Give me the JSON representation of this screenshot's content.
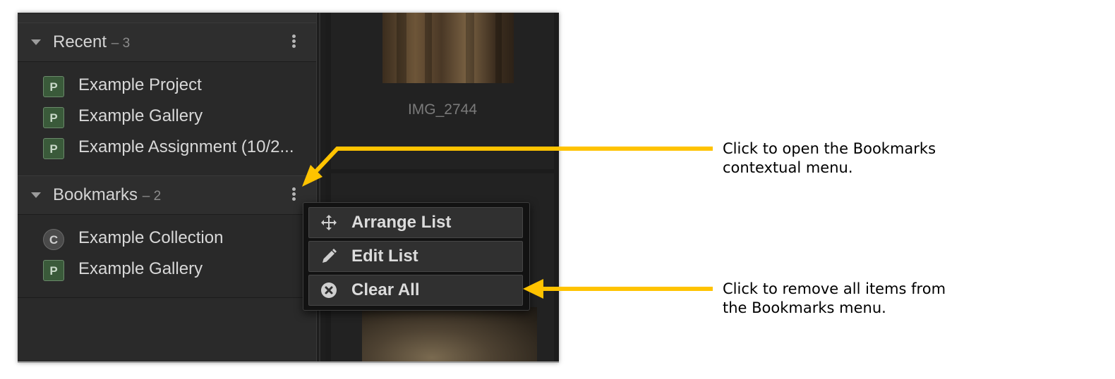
{
  "sidebar": {
    "recent": {
      "title": "Recent",
      "count": "– 3",
      "items": [
        {
          "icon": "P",
          "label": "Example Project"
        },
        {
          "icon": "P",
          "label": "Example Gallery"
        },
        {
          "icon": "P",
          "label": "Example Assignment (10/2..."
        }
      ]
    },
    "bookmarks": {
      "title": "Bookmarks",
      "count": "– 2",
      "items": [
        {
          "icon": "C",
          "label": "Example Collection"
        },
        {
          "icon": "P",
          "label": "Example Gallery"
        }
      ]
    }
  },
  "content": {
    "thumbnail_caption": "IMG_2744"
  },
  "context_menu": {
    "items": [
      {
        "label": "Arrange List",
        "icon": "move-icon"
      },
      {
        "label": "Edit List",
        "icon": "pencil-icon"
      },
      {
        "label": "Clear All",
        "icon": "close-circle-icon"
      }
    ]
  },
  "annotations": {
    "callout_menu": {
      "line1": "Click to open the Bookmarks",
      "line2": "contextual menu."
    },
    "callout_clear": {
      "line1": "Click to remove all items from",
      "line2": "the Bookmarks menu."
    }
  },
  "colors": {
    "arrow": "#FFC300",
    "panel_bg": "#2a2a2a",
    "menu_bg": "#121212"
  }
}
